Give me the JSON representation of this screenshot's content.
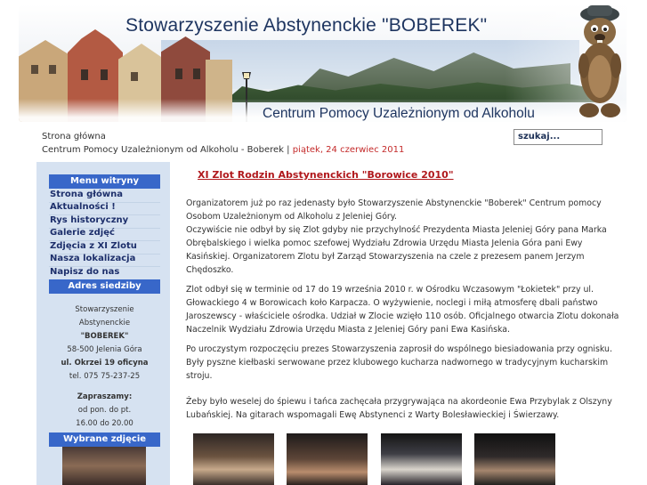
{
  "header": {
    "title": "Stowarzyszenie Abstynenckie \"BOBEREK\"",
    "subtitle": "Centrum Pomocy Uzależnionym od Alkoholu"
  },
  "breadcrumb": {
    "home": "Strona główna",
    "path": "Centrum Pomocy Uzależnionym od Alkoholu - Boberek |",
    "date": "piątek, 24 czerwiec 2011"
  },
  "search": {
    "value": "szukaj..."
  },
  "sidebar": {
    "menu_title": "Menu witryny",
    "items": [
      {
        "label": "Strona główna"
      },
      {
        "label": "Aktualności !"
      },
      {
        "label": "Rys historyczny"
      },
      {
        "label": "Galerie zdjęć"
      },
      {
        "label": "Zdjęcia z XI Zlotu"
      },
      {
        "label": "Nasza lokalizacja"
      },
      {
        "label": "Napisz do nas"
      }
    ],
    "address_title": "Adres siedziby",
    "address": {
      "line1": "Stowarzyszenie",
      "line2": "Abstynenckie",
      "line3": "\"BOBEREK\"",
      "line4": "58-500 Jelenia Góra",
      "line5": "ul. Okrzei 19 oficyna",
      "line6": "tel. 075 75-237-25",
      "invite": "Zapraszamy:",
      "days": "od pon. do pt.",
      "hours": "16.00 do 20.00"
    },
    "photo_title": "Wybrane zdjęcie"
  },
  "article": {
    "title": "XI Zlot Rodzin Abstynenckich \"Borowice 2010\"",
    "paragraphs": [
      [
        "Organizatorem już po raz jedenasty było Stowarzyszenie Abstynenckie \"Boberek\" Centrum pomocy",
        "Osobom Uzależnionym od Alkoholu z Jeleniej Góry.",
        "Oczywiście nie odbył by się Zlot gdyby nie przychylność Prezydenta Miasta Jeleniej Góry pana Marka",
        "Obrębalskiego i wielka pomoc szefowej Wydziału Zdrowia Urzędu Miasta Jelenia Góra pani Ewy",
        "Kasińskiej. Organizatorem Zlotu był Zarząd Stowarzyszenia na czele z prezesem panem Jerzym",
        "Chędoszko."
      ],
      [
        "Zlot odbył się w terminie od 17 do 19 września 2010 r. w Ośrodku Wczasowym \"Łokietek\" przy ul.",
        "Głowackiego 4 w Borowicach koło Karpacza. O wyżywienie, noclegi i miłą atmosferę dbali państwo",
        "Jaroszewscy - właściciele ośrodka. Udział w Zlocie wzięło 110 osób. Oficjalnego otwarcia Zlotu dokonała",
        "Naczelnik Wydziału Zdrowia Urzędu Miasta z Jeleniej Góry pani Ewa Kasińska."
      ],
      [
        "Po uroczystym rozpoczęciu prezes Stowarzyszenia zaprosił do wspólnego biesiadowania przy ognisku.",
        "Były pyszne kiełbaski serwowane przez klubowego kucharza nadwornego w tradycyjnym kucharskim",
        "stroju."
      ],
      [
        "Żeby było weselej do śpiewu i tańca zachęcała przygrywająca na akordeonie Ewa Przybylak z Olszyny",
        "Lubańskiej. Na gitarach wspomagali Ewę Abstynenci z Warty Bolesławieckiej i Świerzawy."
      ]
    ]
  },
  "colors": {
    "accent": "#3867c9",
    "sidebar_bg": "#d6e2f1",
    "title_red": "#b0181c",
    "header_text": "#1e3560"
  }
}
